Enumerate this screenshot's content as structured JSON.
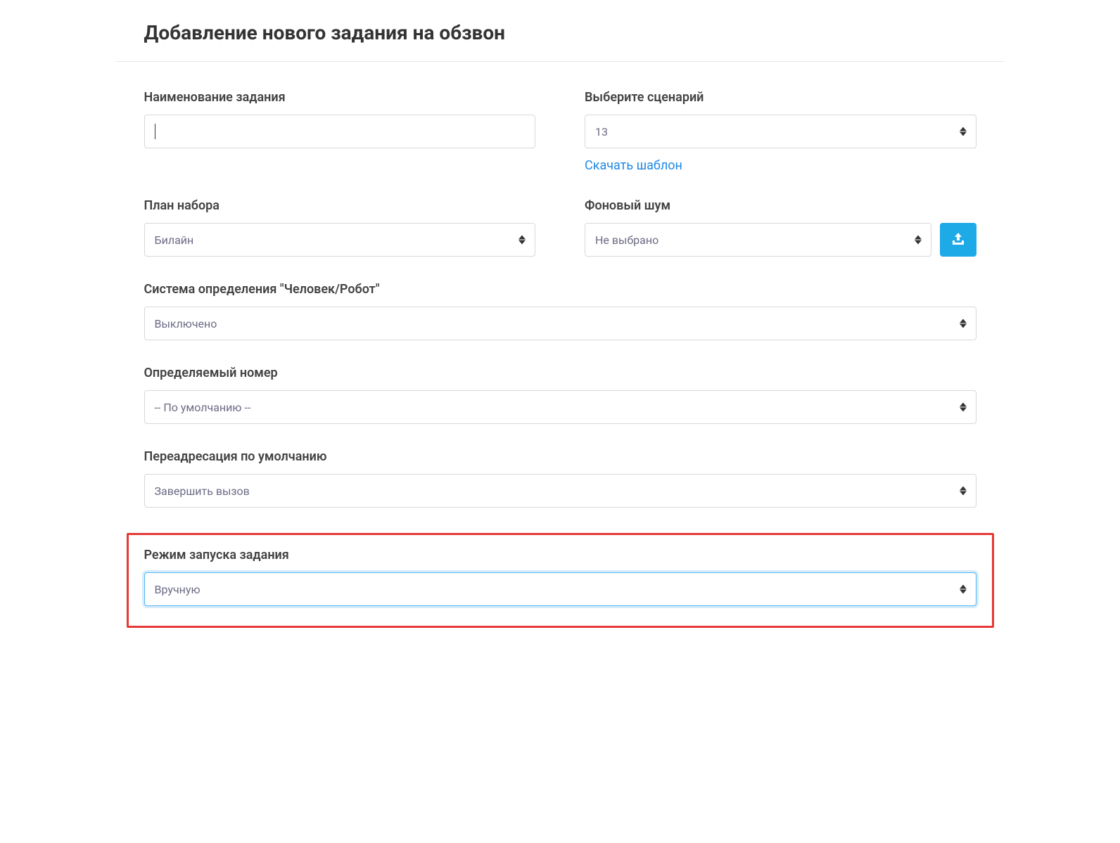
{
  "page_title": "Добавление нового задания на обзвон",
  "fields": {
    "task_name": {
      "label": "Наименование задания",
      "value": ""
    },
    "scenario": {
      "label": "Выберите сценарий",
      "value": "13",
      "download_link": "Скачать шаблон"
    },
    "dial_plan": {
      "label": "План набора",
      "value": "Билайн"
    },
    "background_noise": {
      "label": "Фоновый шум",
      "value": "Не выбрано"
    },
    "detection_system": {
      "label": "Система определения \"Человек/Робот\"",
      "value": "Выключено"
    },
    "caller_id": {
      "label": "Определяемый номер",
      "value": "-- По умолчанию --"
    },
    "default_redirect": {
      "label": "Переадресация по умолчанию",
      "value": "Завершить вызов"
    },
    "launch_mode": {
      "label": "Режим запуска задания",
      "value": "Вручную"
    }
  }
}
